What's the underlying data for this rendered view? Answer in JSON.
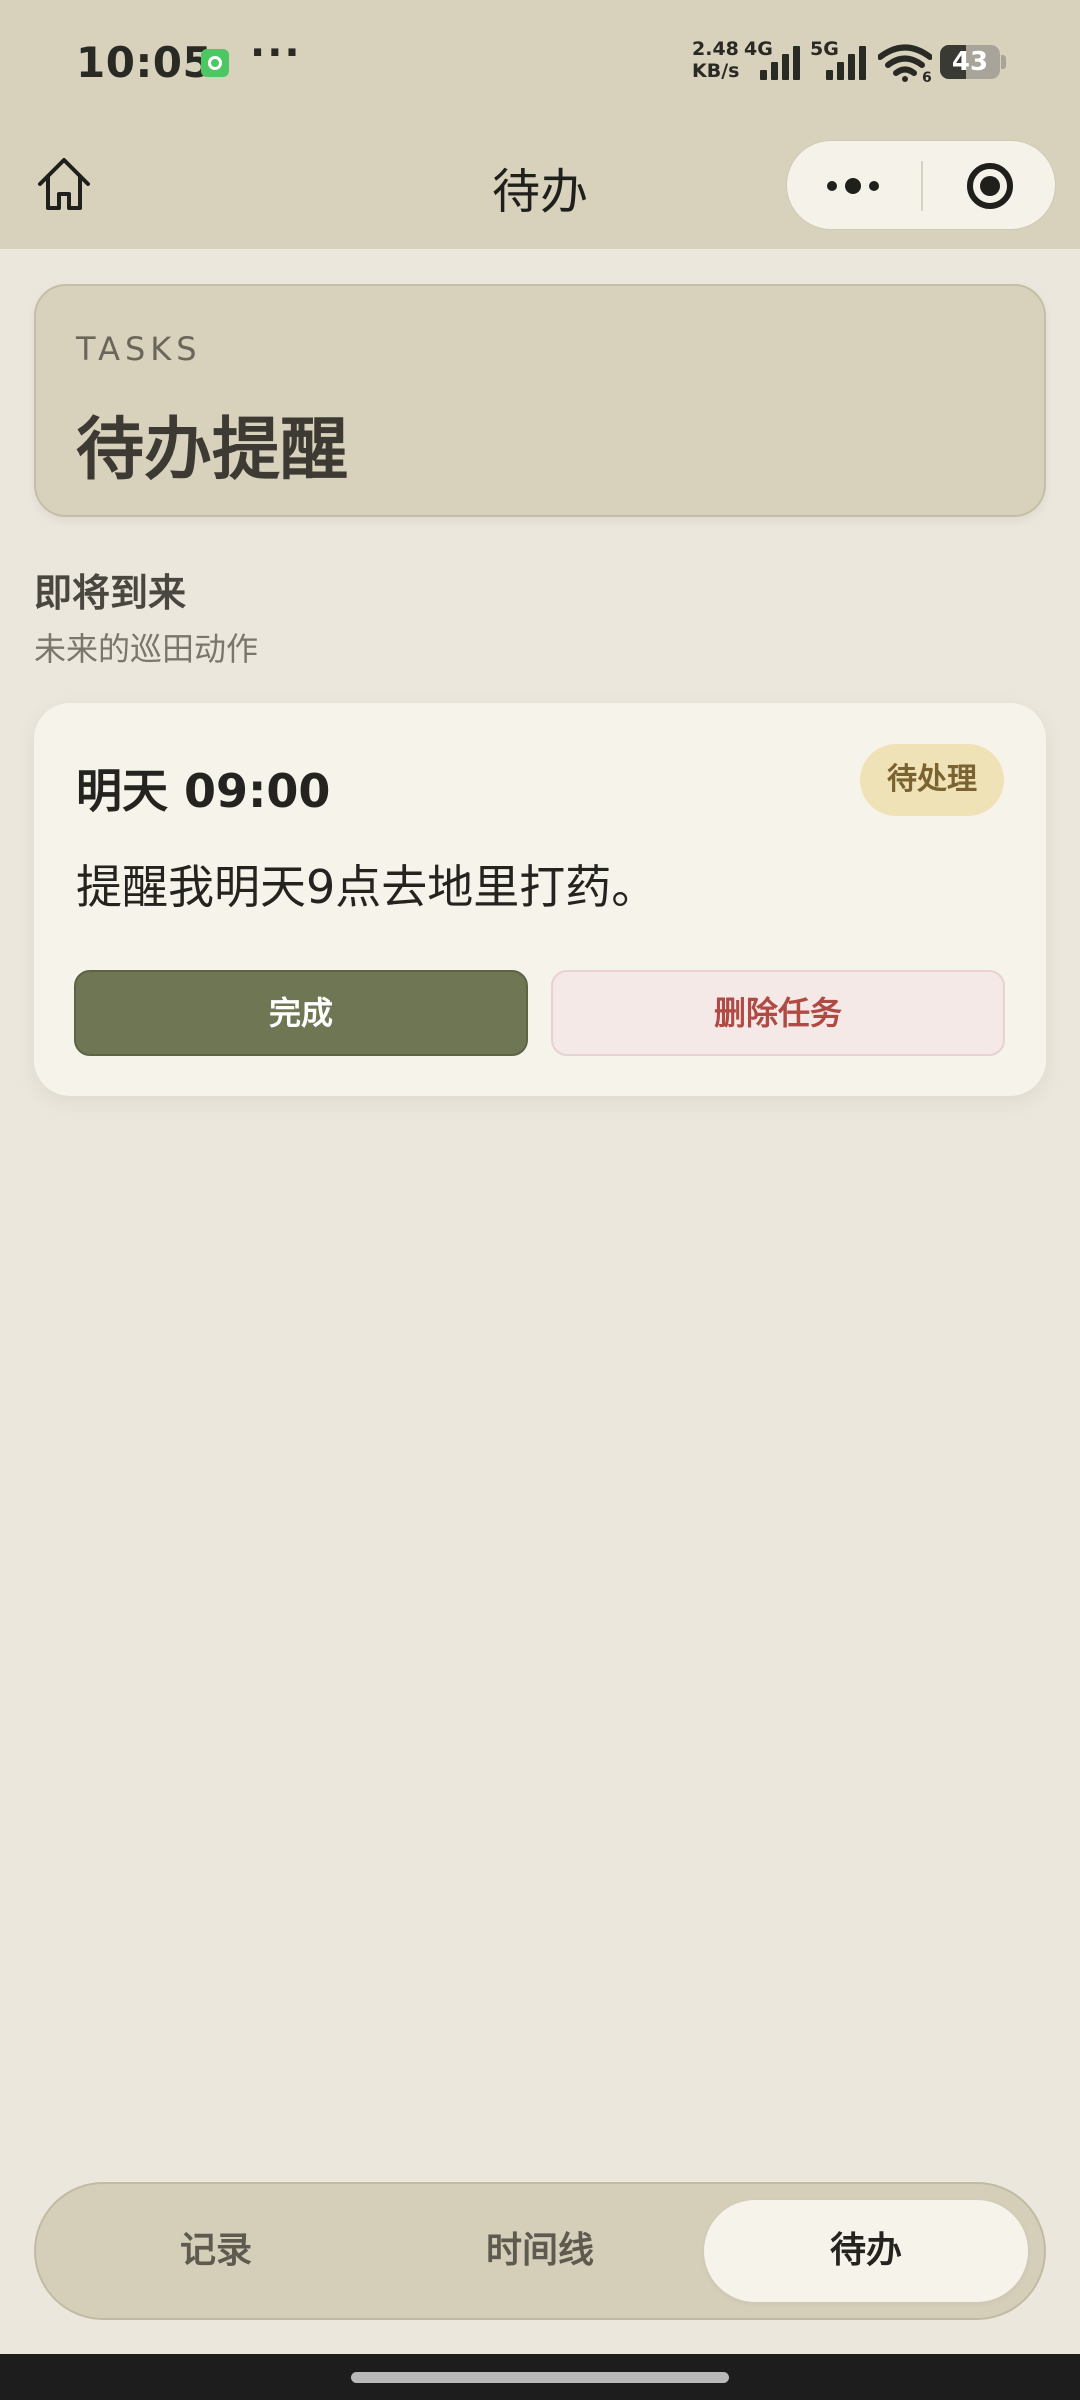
{
  "status_bar": {
    "time": "10:05",
    "dots": "···",
    "speed_value": "2.48",
    "speed_unit": "KB/s",
    "network_1": "4G",
    "network_2": "5G",
    "wifi_sub": "6",
    "battery_level": "43"
  },
  "nav": {
    "title": "待办",
    "home_icon": "home-icon",
    "more_icon": "more-dots-icon",
    "close_icon": "target-circle-icon"
  },
  "header": {
    "eyebrow": "TASKS",
    "title": "待办提醒"
  },
  "section": {
    "title": "即将到来",
    "subtitle": "未来的巡田动作"
  },
  "tasks": [
    {
      "time": "明天 09:00",
      "status": "待处理",
      "text": "提醒我明天9点去地里打药。",
      "done_label": "完成",
      "delete_label": "删除任务"
    }
  ],
  "tab_bar": {
    "tabs": [
      {
        "label": "记录"
      },
      {
        "label": "时间线"
      },
      {
        "label": "待办",
        "active": true
      }
    ]
  },
  "colors": {
    "background": "#ebe7dd",
    "header": "#d8d2bd",
    "card": "#f6f3eb",
    "primary_button": "#6f7653",
    "danger_text": "#b04a44",
    "badge_bg": "#efe2b6"
  }
}
